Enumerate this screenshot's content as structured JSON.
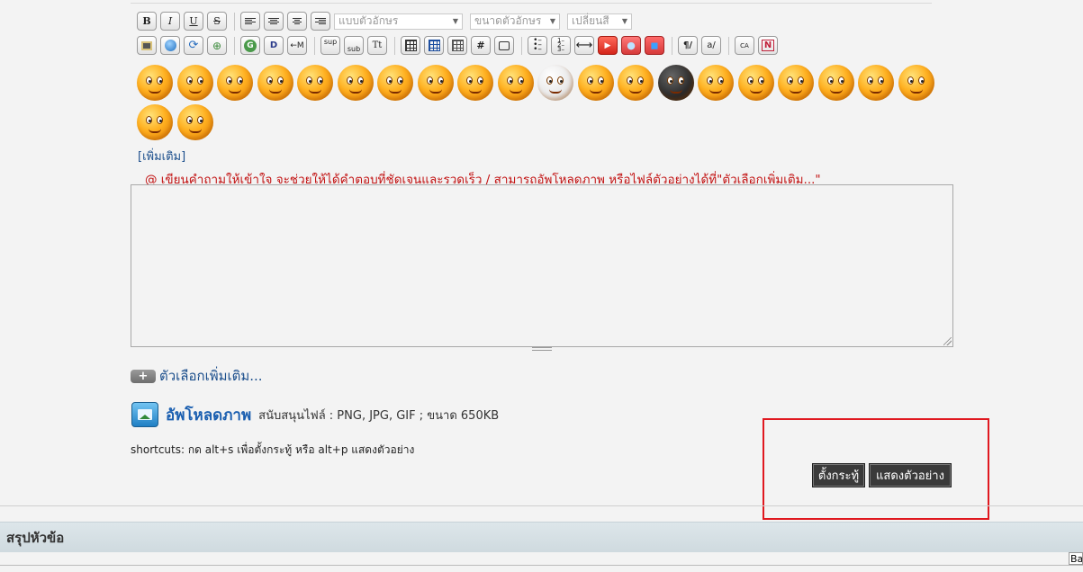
{
  "toolbar": {
    "bold": "B",
    "italic": "I",
    "underline": "U",
    "strike": "S",
    "font_family_placeholder": "แบบตัวอักษร",
    "font_size_placeholder": "ขนาดตัวอักษร",
    "color_placeholder": "เปลี่ยนสี",
    "row2": [
      {
        "name": "image-icon",
        "text": ""
      },
      {
        "name": "globe-link-icon",
        "text": ""
      },
      {
        "name": "refresh-icon",
        "text": ""
      },
      {
        "name": "attach-icon",
        "text": ""
      },
      {
        "name": "google-icon",
        "text": "G"
      },
      {
        "name": "wiki-icon",
        "text": "D"
      },
      {
        "name": "email-icon",
        "text": "←M"
      },
      {
        "name": "superscript-icon",
        "text": "sup"
      },
      {
        "name": "subscript-icon",
        "text": "sub"
      },
      {
        "name": "font-size-icon",
        "text": "Tt"
      },
      {
        "name": "table-icon",
        "text": ""
      },
      {
        "name": "table-header-icon",
        "text": ""
      },
      {
        "name": "table-grid-icon",
        "text": ""
      },
      {
        "name": "hash-icon",
        "text": "#"
      },
      {
        "name": "quote-icon",
        "text": ""
      },
      {
        "name": "bullet-list-icon",
        "text": ""
      },
      {
        "name": "numbered-list-icon",
        "text": ""
      },
      {
        "name": "horizontal-rule-icon",
        "text": "⟷"
      },
      {
        "name": "youtube-icon",
        "text": "▶"
      },
      {
        "name": "video-icon",
        "text": "●"
      },
      {
        "name": "media-icon",
        "text": "◼"
      },
      {
        "name": "paragraph-icon",
        "text": "¶/"
      },
      {
        "name": "spellcheck-icon",
        "text": "a/"
      },
      {
        "name": "translate-icon",
        "text": "CA"
      },
      {
        "name": "clear-format-icon",
        "text": "N"
      }
    ]
  },
  "emoticons": [
    "happy",
    "wink",
    "surprised",
    "sweat",
    "shout",
    "love",
    "laugh",
    "cool",
    "shocked",
    "cry",
    "ghost",
    "sleepy",
    "dizzy",
    "ninja",
    "grin",
    "smug",
    "confused",
    "crazy",
    "yawn",
    "annoyed",
    "sad",
    "angry"
  ],
  "more_emoticons_link": "[เพิ่มเติม]",
  "hint_text": "@ เขียนคำถามให้เข้าใจ จะช่วยให้ได้คำตอบที่ชัดเจนและรวดเร็ว / สามารถอัพโหลดภาพ หรือไฟล์ตัวอย่างได้ที่\"ตัวเลือกเพิ่มเติม...\"",
  "more_options": {
    "plus": "+",
    "label": "ตัวเลือกเพิ่มเติม..."
  },
  "upload": {
    "label": "อัพโหลดภาพ",
    "info": "สนับสนุนไฟล์ : PNG, JPG, GIF ; ขนาด 650KB"
  },
  "shortcuts": "shortcuts: กด alt+s เพื่อตั้งกระทู้ หรือ alt+p แสดงตัวอย่าง",
  "buttons": {
    "submit": "ตั้งกระทู้",
    "preview": "แสดงตัวอย่าง"
  },
  "summary_title": "สรุปหัวข้อ",
  "corner_text": "Ba",
  "colors": {
    "hint_red": "#c21212",
    "link_blue": "#1b4e8c",
    "highlight_red": "#e0181f"
  }
}
